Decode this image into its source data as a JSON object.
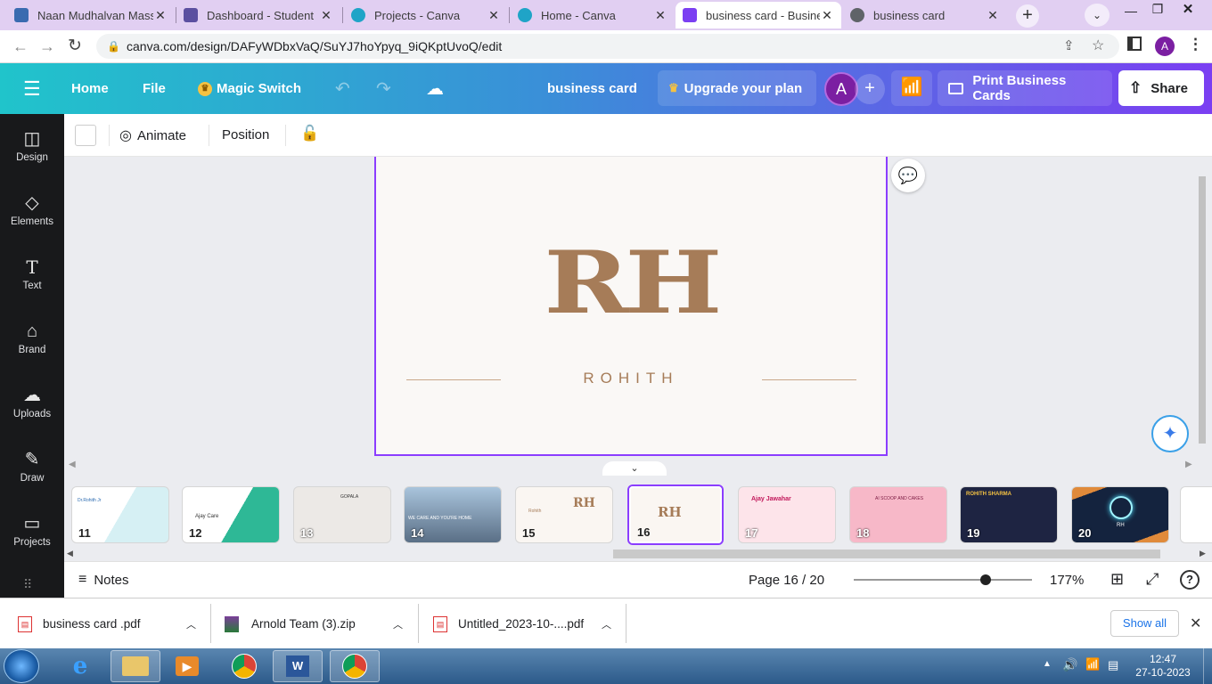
{
  "browser": {
    "tabs": [
      {
        "title": "Naan Mudhalvan Mass",
        "active": false,
        "icon_color": "#3a6bb0"
      },
      {
        "title": "Dashboard - Student",
        "active": false,
        "icon_color": "#5b4fa0"
      },
      {
        "title": "Projects - Canva",
        "active": false,
        "icon_color": "#1fa4c7"
      },
      {
        "title": "Home - Canva",
        "active": false,
        "icon_color": "#1fa4c7"
      },
      {
        "title": "business card - Busines",
        "active": true,
        "icon_color": "#7b3ff2"
      },
      {
        "title": "business card",
        "active": false,
        "icon_color": "#5f6368"
      }
    ],
    "url": "canva.com/design/DAFyWDbxVaQ/SuYJ7hoYpyq_9iQKptUvoQ/edit",
    "profile_initial": "A"
  },
  "header": {
    "home": "Home",
    "file": "File",
    "magic_switch": "Magic Switch",
    "doc_title": "business card",
    "upgrade": "Upgrade your plan",
    "avatar_initial": "A",
    "print": "Print Business Cards",
    "share": "Share"
  },
  "sidebar": {
    "items": [
      {
        "label": "Design",
        "icon": "design-icon"
      },
      {
        "label": "Elements",
        "icon": "elements-icon"
      },
      {
        "label": "Text",
        "icon": "text-icon"
      },
      {
        "label": "Brand",
        "icon": "brand-icon"
      },
      {
        "label": "Uploads",
        "icon": "uploads-icon"
      },
      {
        "label": "Draw",
        "icon": "draw-icon"
      },
      {
        "label": "Projects",
        "icon": "projects-icon"
      }
    ]
  },
  "toolbar": {
    "animate": "Animate",
    "position": "Position"
  },
  "card": {
    "monogram": "RH",
    "name": "ROHITH",
    "text_color": "#a67c58"
  },
  "pages": [
    {
      "num": "11",
      "label": "Dr.Rohith Jr"
    },
    {
      "num": "12",
      "label": "Ajay Care"
    },
    {
      "num": "13",
      "label": "GOPALA"
    },
    {
      "num": "14",
      "label": "WE CARE AND YOU'RE HOME"
    },
    {
      "num": "15",
      "label": "Rohith"
    },
    {
      "num": "16",
      "label": "RH"
    },
    {
      "num": "17",
      "label": "Ajay Jawahar"
    },
    {
      "num": "18",
      "label": "AI SCOOP AND CAKES"
    },
    {
      "num": "19",
      "label": "ROHITH SHARMA"
    },
    {
      "num": "20",
      "label": "RH"
    }
  ],
  "selected_page": "16",
  "bottom": {
    "notes": "Notes",
    "page_indicator": "Page 16 / 20",
    "zoom": "177%",
    "zoom_level": 0.74
  },
  "downloads": [
    {
      "name": "business card .pdf",
      "type": "pdf"
    },
    {
      "name": "Arnold Team (3).zip",
      "type": "zip"
    },
    {
      "name": "Untitled_2023-10-....pdf",
      "type": "pdf"
    }
  ],
  "downloads_show_all": "Show all",
  "clock": {
    "time": "12:47",
    "date": "27-10-2023"
  }
}
